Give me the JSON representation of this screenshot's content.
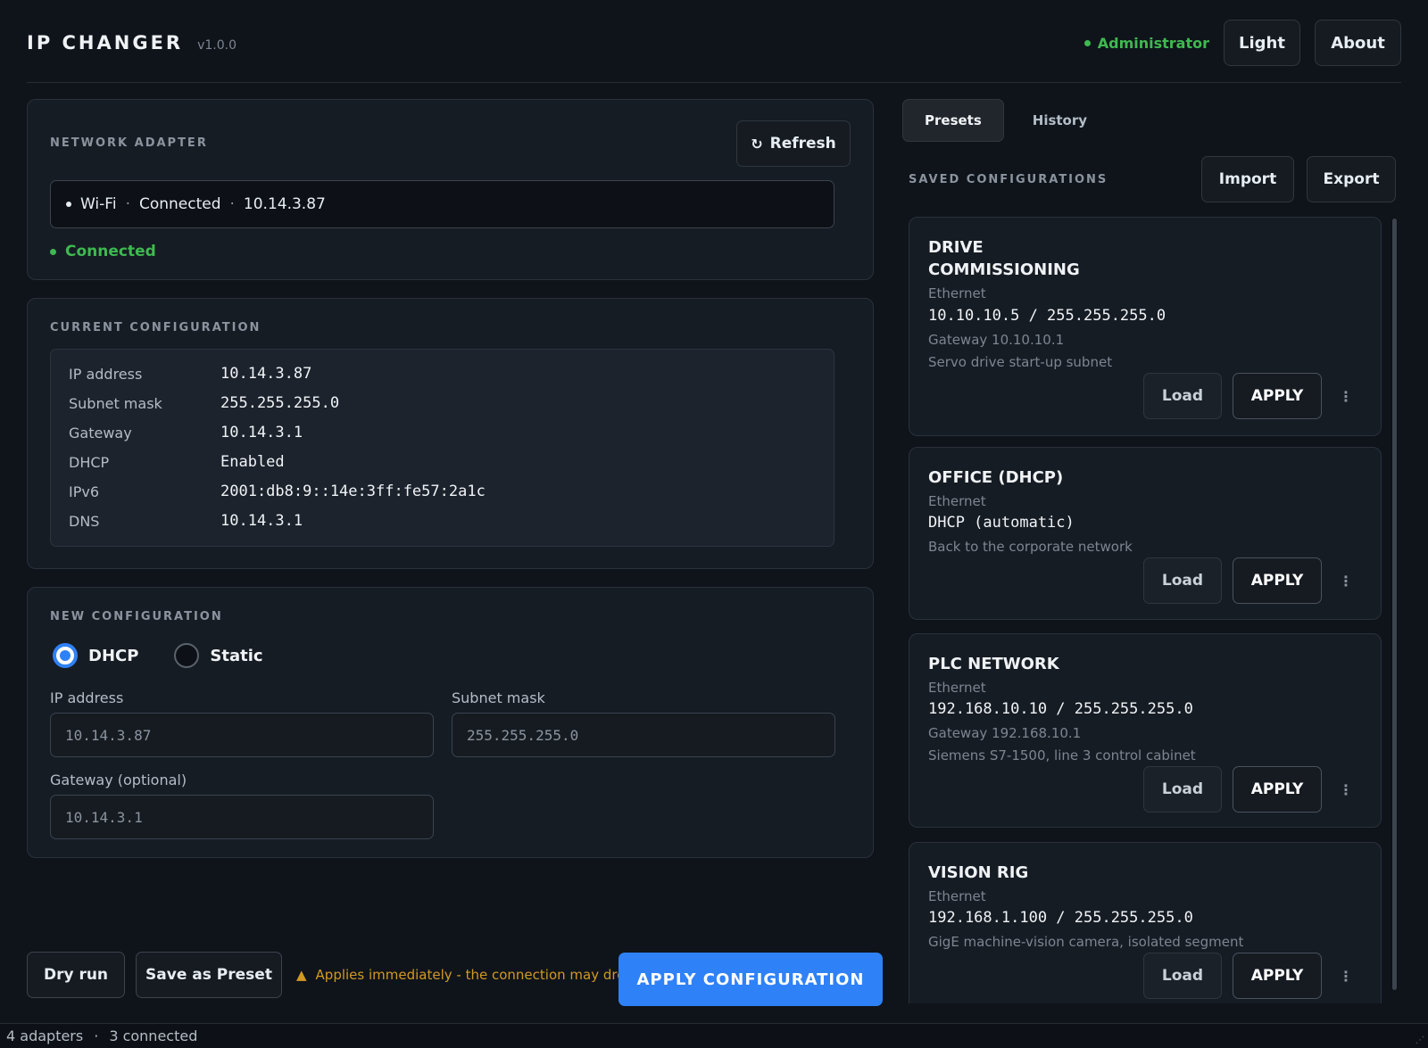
{
  "header": {
    "title": "IP CHANGER",
    "version": "v1.0.0",
    "role": "Administrator",
    "theme_button": "Light",
    "about_button": "About"
  },
  "adapter": {
    "section_label": "NETWORK ADAPTER",
    "refresh_label": "Refresh",
    "selected": {
      "name": "Wi-Fi",
      "state": "Connected",
      "ip": "10.14.3.87"
    },
    "status": "Connected"
  },
  "current": {
    "section_label": "CURRENT CONFIGURATION",
    "rows": [
      {
        "key": "IP address",
        "value": "10.14.3.87"
      },
      {
        "key": "Subnet mask",
        "value": "255.255.255.0"
      },
      {
        "key": "Gateway",
        "value": "10.14.3.1"
      },
      {
        "key": "DHCP",
        "value": "Enabled"
      },
      {
        "key": "IPv6",
        "value": "2001:db8:9::14e:3ff:fe57:2a1c"
      },
      {
        "key": "DNS",
        "value": "10.14.3.1"
      }
    ]
  },
  "new_config": {
    "section_label": "NEW CONFIGURATION",
    "mode_dhcp": "DHCP",
    "mode_static": "Static",
    "selected_mode": "DHCP",
    "ip_label": "IP address",
    "ip_placeholder": "10.14.3.87",
    "subnet_label": "Subnet mask",
    "subnet_placeholder": "255.255.255.0",
    "gateway_label": "Gateway (optional)",
    "gateway_placeholder": "10.14.3.1"
  },
  "actions": {
    "dry_run": "Dry run",
    "save_preset": "Save as Preset",
    "warning": "Applies immediately - the connection may drop",
    "apply": "APPLY CONFIGURATION"
  },
  "right": {
    "tab_presets": "Presets",
    "tab_history": "History",
    "saved_label": "SAVED CONFIGURATIONS",
    "import_label": "Import",
    "export_label": "Export",
    "load_label": "Load",
    "apply_label": "APPLY",
    "more_label": "⋮",
    "presets": [
      {
        "name": "DRIVE COMMISSIONING",
        "type": "Ethernet",
        "address": "10.10.10.5 / 255.255.255.0",
        "gateway": "Gateway 10.10.10.1",
        "note": "Servo drive start-up subnet"
      },
      {
        "name": "OFFICE (DHCP)",
        "type": "Ethernet",
        "address": "DHCP (automatic)",
        "gateway": "",
        "note": "Back to the corporate network"
      },
      {
        "name": "PLC NETWORK",
        "type": "Ethernet",
        "address": "192.168.10.10 / 255.255.255.0",
        "gateway": "Gateway 192.168.10.1",
        "note": "Siemens S7-1500, line 3 control cabinet"
      },
      {
        "name": "VISION RIG",
        "type": "Ethernet",
        "address": "192.168.1.100 / 255.255.255.0",
        "gateway": "",
        "note": "GigE machine-vision camera, isolated segment"
      }
    ]
  },
  "statusbar": {
    "adapters": "4 adapters",
    "separator": "·",
    "connected": "3 connected"
  },
  "colors": {
    "accent": "#2f81f7",
    "success": "#3fb950",
    "warning": "#d29922",
    "background": "#0f141b"
  }
}
